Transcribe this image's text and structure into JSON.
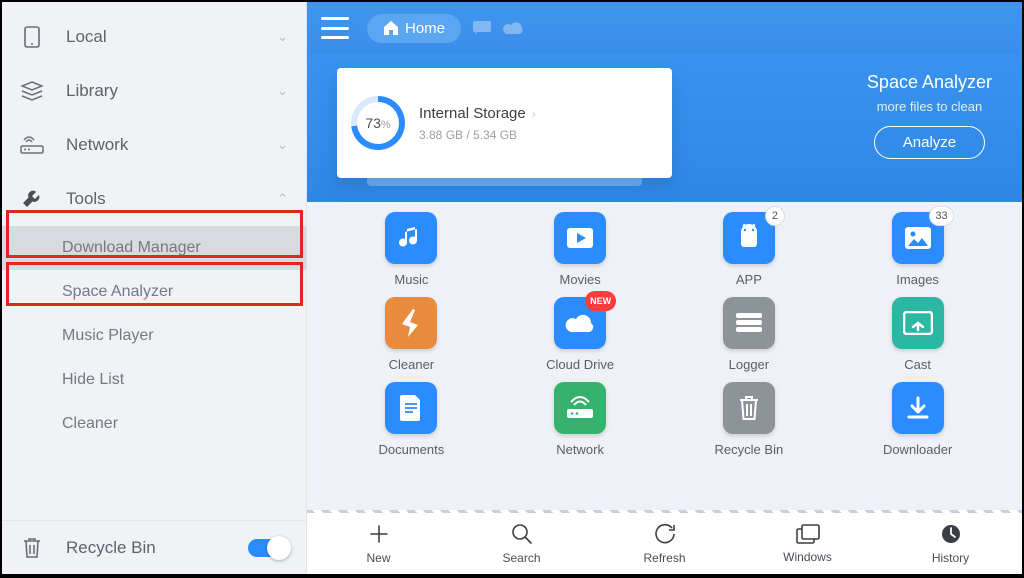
{
  "sidebar": {
    "items": [
      {
        "label": "Local"
      },
      {
        "label": "Library"
      },
      {
        "label": "Network"
      },
      {
        "label": "Tools"
      },
      {
        "label": "Recycle Bin"
      }
    ],
    "tools_children": [
      {
        "label": "Download Manager"
      },
      {
        "label": "Space Analyzer"
      },
      {
        "label": "Music Player"
      },
      {
        "label": "Hide List"
      },
      {
        "label": "Cleaner"
      }
    ]
  },
  "topbar": {
    "home": "Home"
  },
  "storage": {
    "percent": "73",
    "percent_unit": "%",
    "title": "Internal Storage",
    "usage": "3.88 GB / 5.34 GB"
  },
  "analyzer": {
    "title": "Space Analyzer",
    "subtitle": "more files to clean",
    "button": "Analyze"
  },
  "tiles": [
    [
      {
        "name": "music",
        "label": "Music",
        "color": "c-blue",
        "badge": null
      },
      {
        "name": "movies",
        "label": "Movies",
        "color": "c-blue",
        "badge": null
      },
      {
        "name": "app",
        "label": "APP",
        "color": "c-blue",
        "badge": "2"
      },
      {
        "name": "images",
        "label": "Images",
        "color": "c-blue",
        "badge": "33"
      }
    ],
    [
      {
        "name": "cleaner",
        "label": "Cleaner",
        "color": "c-orange",
        "badge": null
      },
      {
        "name": "cloud-drive",
        "label": "Cloud Drive",
        "color": "c-blue",
        "badge": "NEW",
        "badgeType": "new"
      },
      {
        "name": "logger",
        "label": "Logger",
        "color": "c-grey",
        "badge": null
      },
      {
        "name": "cast",
        "label": "Cast",
        "color": "c-teal",
        "badge": null
      }
    ],
    [
      {
        "name": "documents",
        "label": "Documents",
        "color": "c-blue",
        "badge": null
      },
      {
        "name": "network",
        "label": "Network",
        "color": "c-green",
        "badge": null
      },
      {
        "name": "recycle-bin",
        "label": "Recycle Bin",
        "color": "c-grey",
        "badge": null
      },
      {
        "name": "downloader",
        "label": "Downloader",
        "color": "c-blue",
        "badge": null
      }
    ]
  ],
  "bottombar": [
    {
      "name": "new",
      "label": "New"
    },
    {
      "name": "search",
      "label": "Search"
    },
    {
      "name": "refresh",
      "label": "Refresh"
    },
    {
      "name": "windows",
      "label": "Windows"
    },
    {
      "name": "history",
      "label": "History"
    }
  ]
}
